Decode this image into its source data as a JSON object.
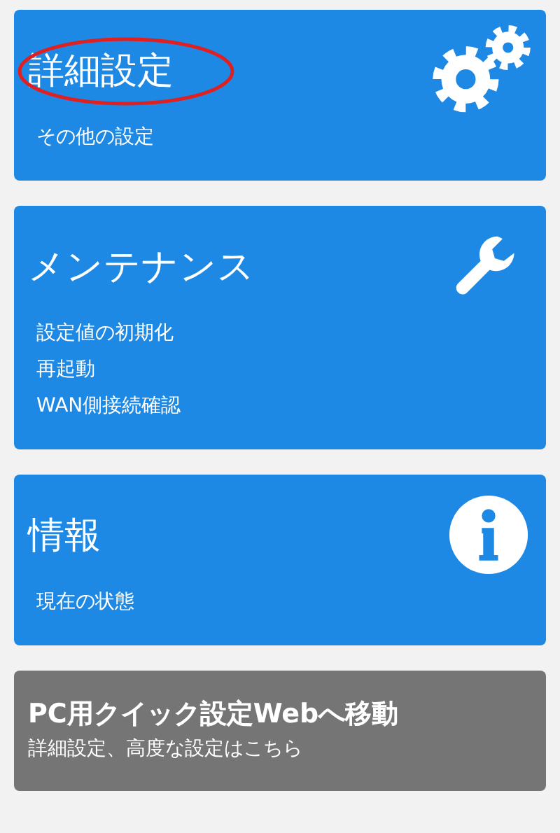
{
  "cards": [
    {
      "kind": "settings",
      "title": "詳細設定",
      "highlighted": true,
      "items": [
        "その他の設定"
      ]
    },
    {
      "kind": "maintenance",
      "title": "メンテナンス",
      "highlighted": false,
      "items": [
        "設定値の初期化",
        "再起動",
        "WAN側接続確認"
      ]
    },
    {
      "kind": "info",
      "title": "情報",
      "highlighted": false,
      "items": [
        "現在の状態"
      ]
    },
    {
      "kind": "link",
      "title": "PC用クイック設定Webへ移動",
      "highlighted": false,
      "items": [
        "詳細設定、高度な設定はこちら"
      ]
    }
  ]
}
